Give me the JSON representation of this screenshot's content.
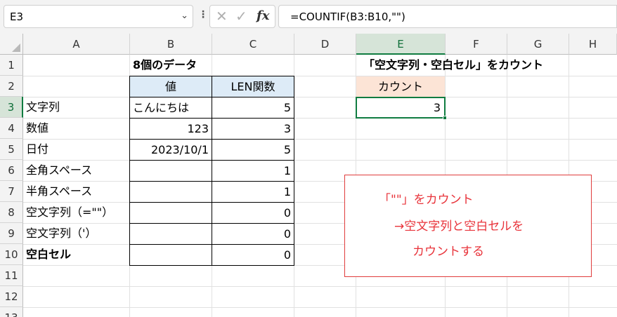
{
  "formula_bar": {
    "name_box": "E3",
    "formula": "=COUNTIF(B3:B10,\"\")"
  },
  "columns": [
    "A",
    "B",
    "C",
    "D",
    "E",
    "F",
    "G",
    "H"
  ],
  "rows": [
    "1",
    "2",
    "3",
    "4",
    "5",
    "6",
    "7",
    "8",
    "9",
    "10",
    "11",
    "12",
    "13"
  ],
  "cells": {
    "B1": "8個のデータ",
    "B2": "値",
    "C2": "LEN関数",
    "A3": "文字列",
    "A4": "数値",
    "A5": "日付",
    "A6": "全角スペース",
    "A7": "半角スペース",
    "A8": "空文字列（=\"\"）",
    "A9": "空文字列（'）",
    "A10": "空白セル",
    "B3": "こんにちは",
    "B4": "123",
    "B5": "2023/10/1",
    "C3": "5",
    "C4": "3",
    "C5": "5",
    "C6": "1",
    "C7": "1",
    "C8": "0",
    "C9": "0",
    "C10": "0",
    "E1": "「空文字列・空白セル」をカウント",
    "E2": "カウント",
    "E3": "3"
  },
  "note": {
    "line1": "「\"\"」をカウント",
    "line2": "→空文字列と空白セルを",
    "line3": "カウントする"
  },
  "colors": {
    "selection_green": "#107c41",
    "header_blue": "#ddebf7",
    "header_peach": "#fce4d6",
    "note_red": "#e8333a"
  }
}
